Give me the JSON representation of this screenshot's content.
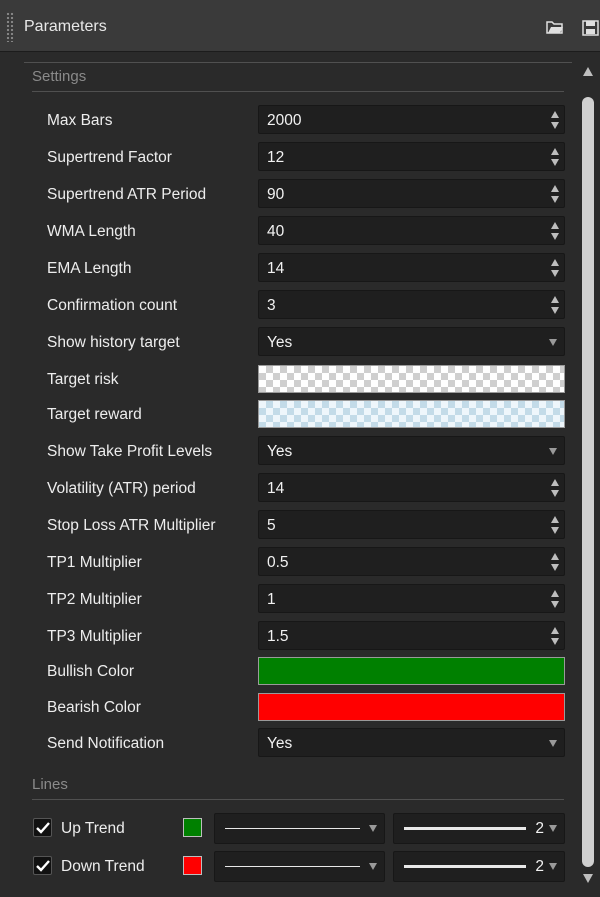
{
  "window": {
    "title": "Parameters",
    "icons": [
      "folder-open-icon",
      "save-icon"
    ]
  },
  "settings": {
    "header": "Settings",
    "rows": [
      {
        "label": "Max Bars",
        "type": "spinner",
        "value": "2000"
      },
      {
        "label": "Supertrend Factor",
        "type": "spinner",
        "value": "12"
      },
      {
        "label": "Supertrend ATR Period",
        "type": "spinner",
        "value": "90"
      },
      {
        "label": "WMA Length",
        "type": "spinner",
        "value": "40"
      },
      {
        "label": "EMA Length",
        "type": "spinner",
        "value": "14"
      },
      {
        "label": "Confirmation count",
        "type": "spinner",
        "value": "3"
      },
      {
        "label": "Show history target",
        "type": "dropdown",
        "value": "Yes"
      },
      {
        "label": "Target risk",
        "type": "color",
        "value": "#ffffff"
      },
      {
        "label": "Target reward",
        "type": "color",
        "value": "#d6eaf5"
      },
      {
        "label": "Show Take Profit Levels",
        "type": "dropdown",
        "value": "Yes"
      },
      {
        "label": "Volatility (ATR) period",
        "type": "spinner",
        "value": "14"
      },
      {
        "label": "Stop Loss ATR Multiplier",
        "type": "spinner",
        "value": "5"
      },
      {
        "label": "TP1 Multiplier",
        "type": "spinner",
        "value": "0.5"
      },
      {
        "label": "TP2 Multiplier",
        "type": "spinner",
        "value": "1"
      },
      {
        "label": "TP3 Multiplier",
        "type": "spinner",
        "value": "1.5"
      },
      {
        "label": "Bullish Color",
        "type": "color",
        "value": "#008000"
      },
      {
        "label": "Bearish Color",
        "type": "color",
        "value": "#ff0000"
      },
      {
        "label": "Send Notification",
        "type": "dropdown",
        "value": "Yes"
      }
    ]
  },
  "lines": {
    "header": "Lines",
    "items": [
      {
        "label": "Up Trend",
        "checked": true,
        "color": "#008000",
        "thickness": "2"
      },
      {
        "label": "Down Trend",
        "checked": true,
        "color": "#ff0000",
        "thickness": "2"
      }
    ]
  }
}
